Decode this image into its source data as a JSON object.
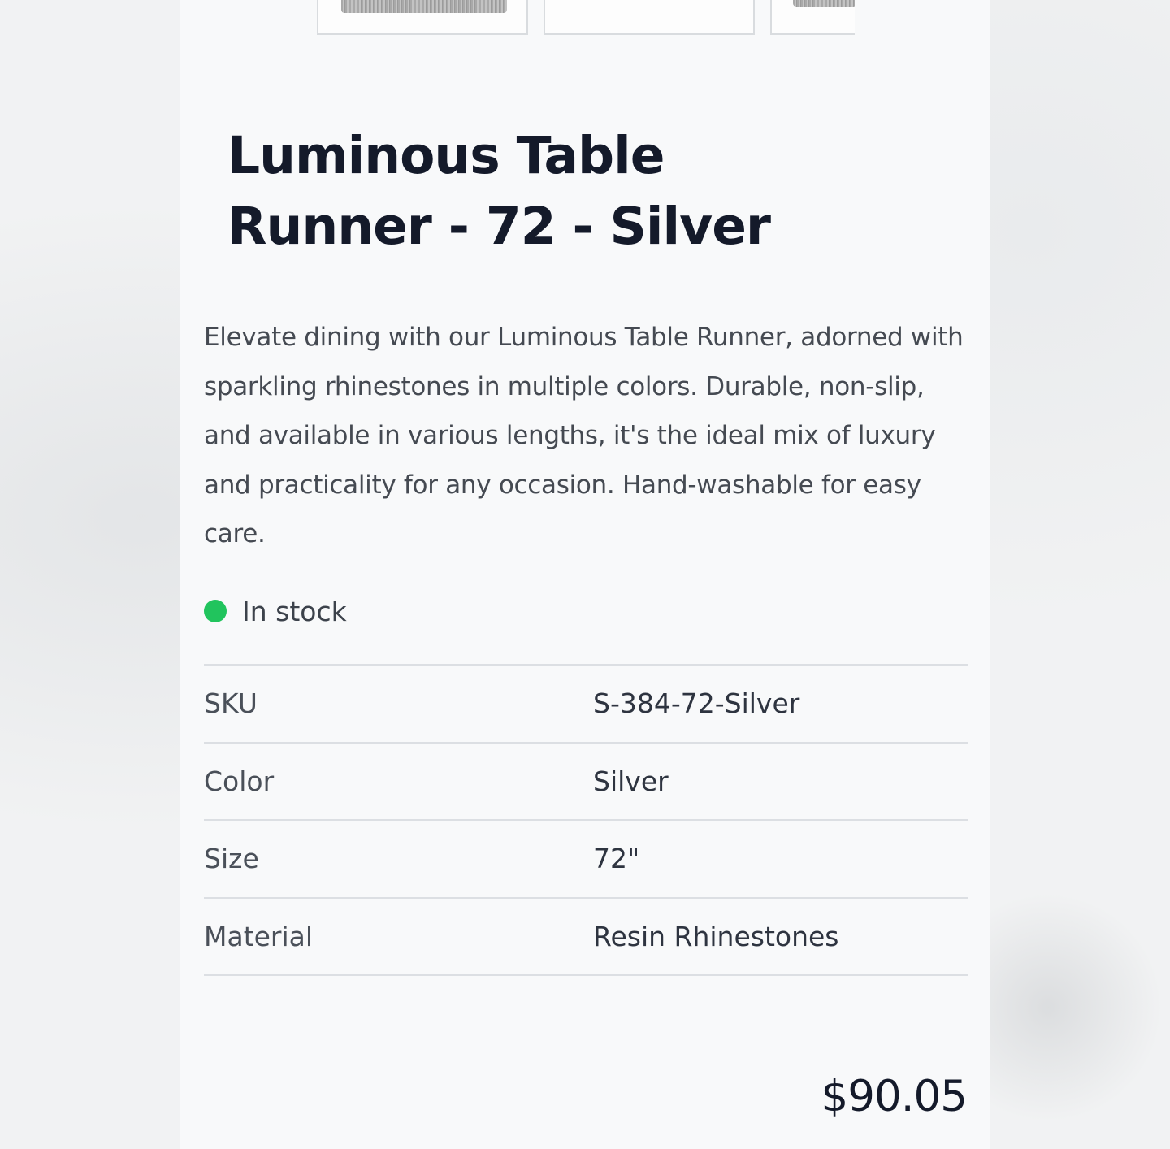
{
  "product": {
    "title": "Luminous Table Runner - 72 - Silver",
    "description": "Elevate dining with our Luminous Table Runner, adorned with sparkling rhinestones in multiple colors. Durable, non-slip, and available in various lengths, it's the ideal mix of luxury and practicality for any occasion. Hand-washable for easy care.",
    "stock_status": "In stock",
    "stock_color": "#21c45d",
    "price": "$90.05"
  },
  "specs": [
    {
      "label": "SKU",
      "value": "S-384-72-Silver"
    },
    {
      "label": "Color",
      "value": "Silver"
    },
    {
      "label": "Size",
      "value": "72\""
    },
    {
      "label": "Material",
      "value": "Resin Rhinestones"
    }
  ]
}
